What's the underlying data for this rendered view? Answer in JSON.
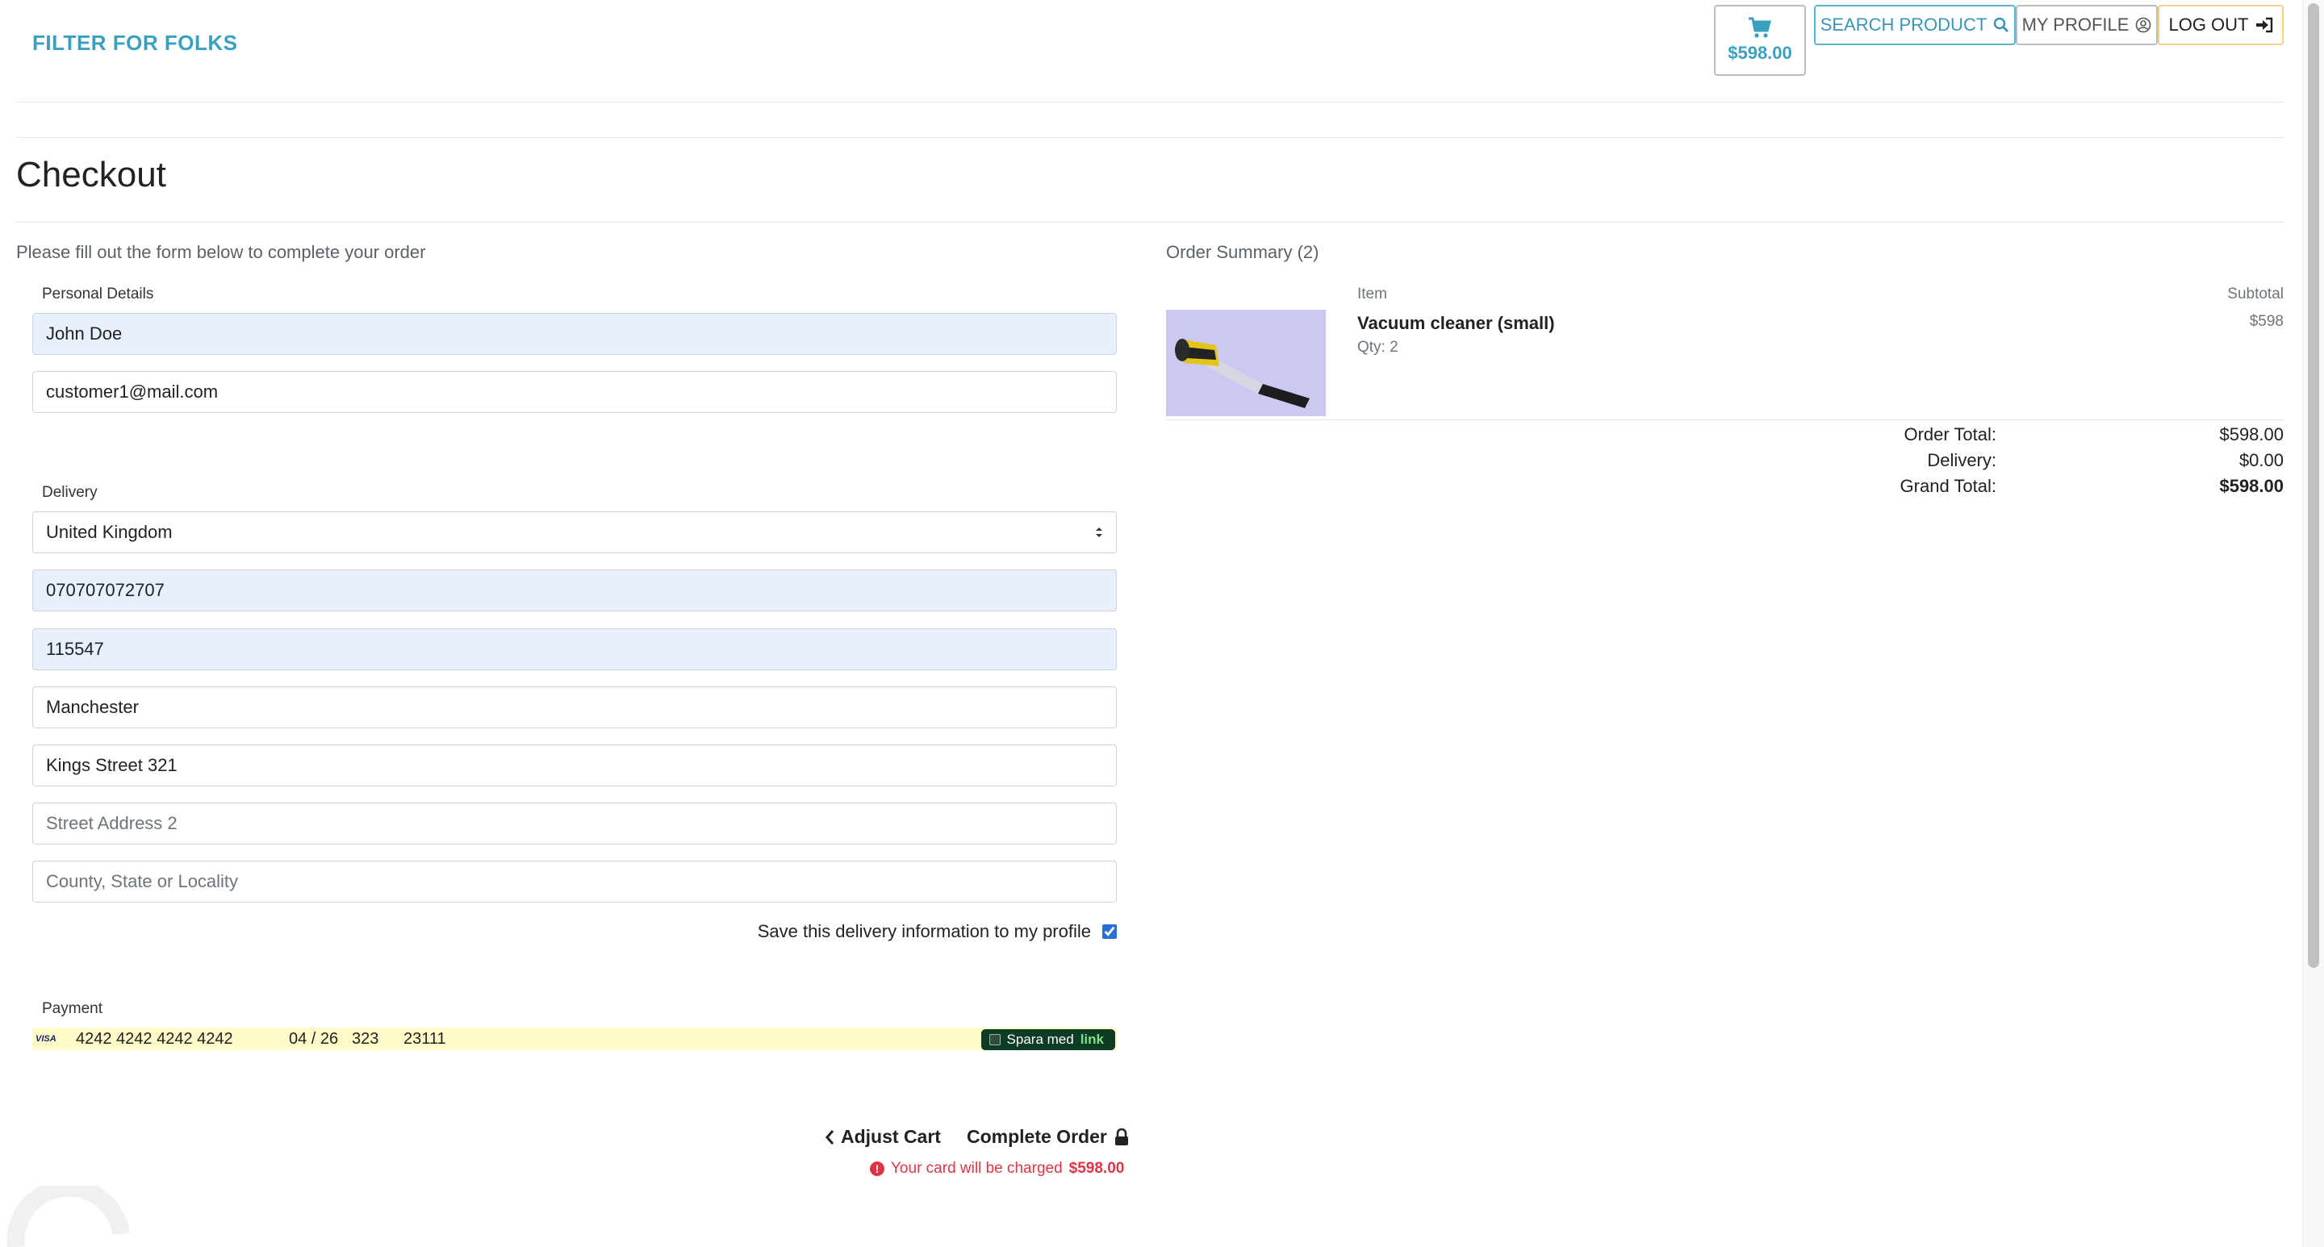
{
  "header": {
    "brand": "FILTER FOR FOLKS",
    "cart_total": "$598.00",
    "search_label": "SEARCH PRODUCT",
    "profile_label": "MY PROFILE",
    "logout_label": "LOG OUT"
  },
  "page": {
    "title": "Checkout",
    "lead": "Please fill out the form below to complete your order"
  },
  "form": {
    "personal_label": "Personal Details",
    "full_name": "John Doe",
    "email": "customer1@mail.com",
    "delivery_label": "Delivery",
    "country": "United Kingdom",
    "phone": "070707072707",
    "postcode": "115547",
    "town": "Manchester",
    "street1": "Kings Street 321",
    "street2_placeholder": "Street Address 2",
    "county_placeholder": "County, State or Locality",
    "save_label": "Save this delivery information to my profile",
    "save_checked": true,
    "payment_label": "Payment",
    "card_brand": "VISA",
    "card_number": "4242 4242 4242 4242",
    "card_expiry": "04 / 26",
    "card_cvc": "323",
    "card_zip": "23111",
    "link_text": "Spara med",
    "link_brand": "link"
  },
  "actions": {
    "adjust_cart": "Adjust Cart",
    "complete_order": "Complete Order",
    "charge_text": "Your card will be charged",
    "charge_amount": "$598.00"
  },
  "summary": {
    "title": "Order Summary (2)",
    "col_item": "Item",
    "col_subtotal": "Subtotal",
    "item_name": "Vacuum cleaner (small)",
    "item_qty": "Qty: 2",
    "item_subtotal": "$598",
    "order_total_label": "Order Total:",
    "order_total": "$598.00",
    "delivery_label": "Delivery:",
    "delivery": "$0.00",
    "grand_total_label": "Grand Total:",
    "grand_total": "$598.00"
  },
  "colors": {
    "brand": "#3aa0c0",
    "autofill": "#e8f0fe",
    "danger": "#dc3545",
    "link_green": "#0d3b24"
  }
}
